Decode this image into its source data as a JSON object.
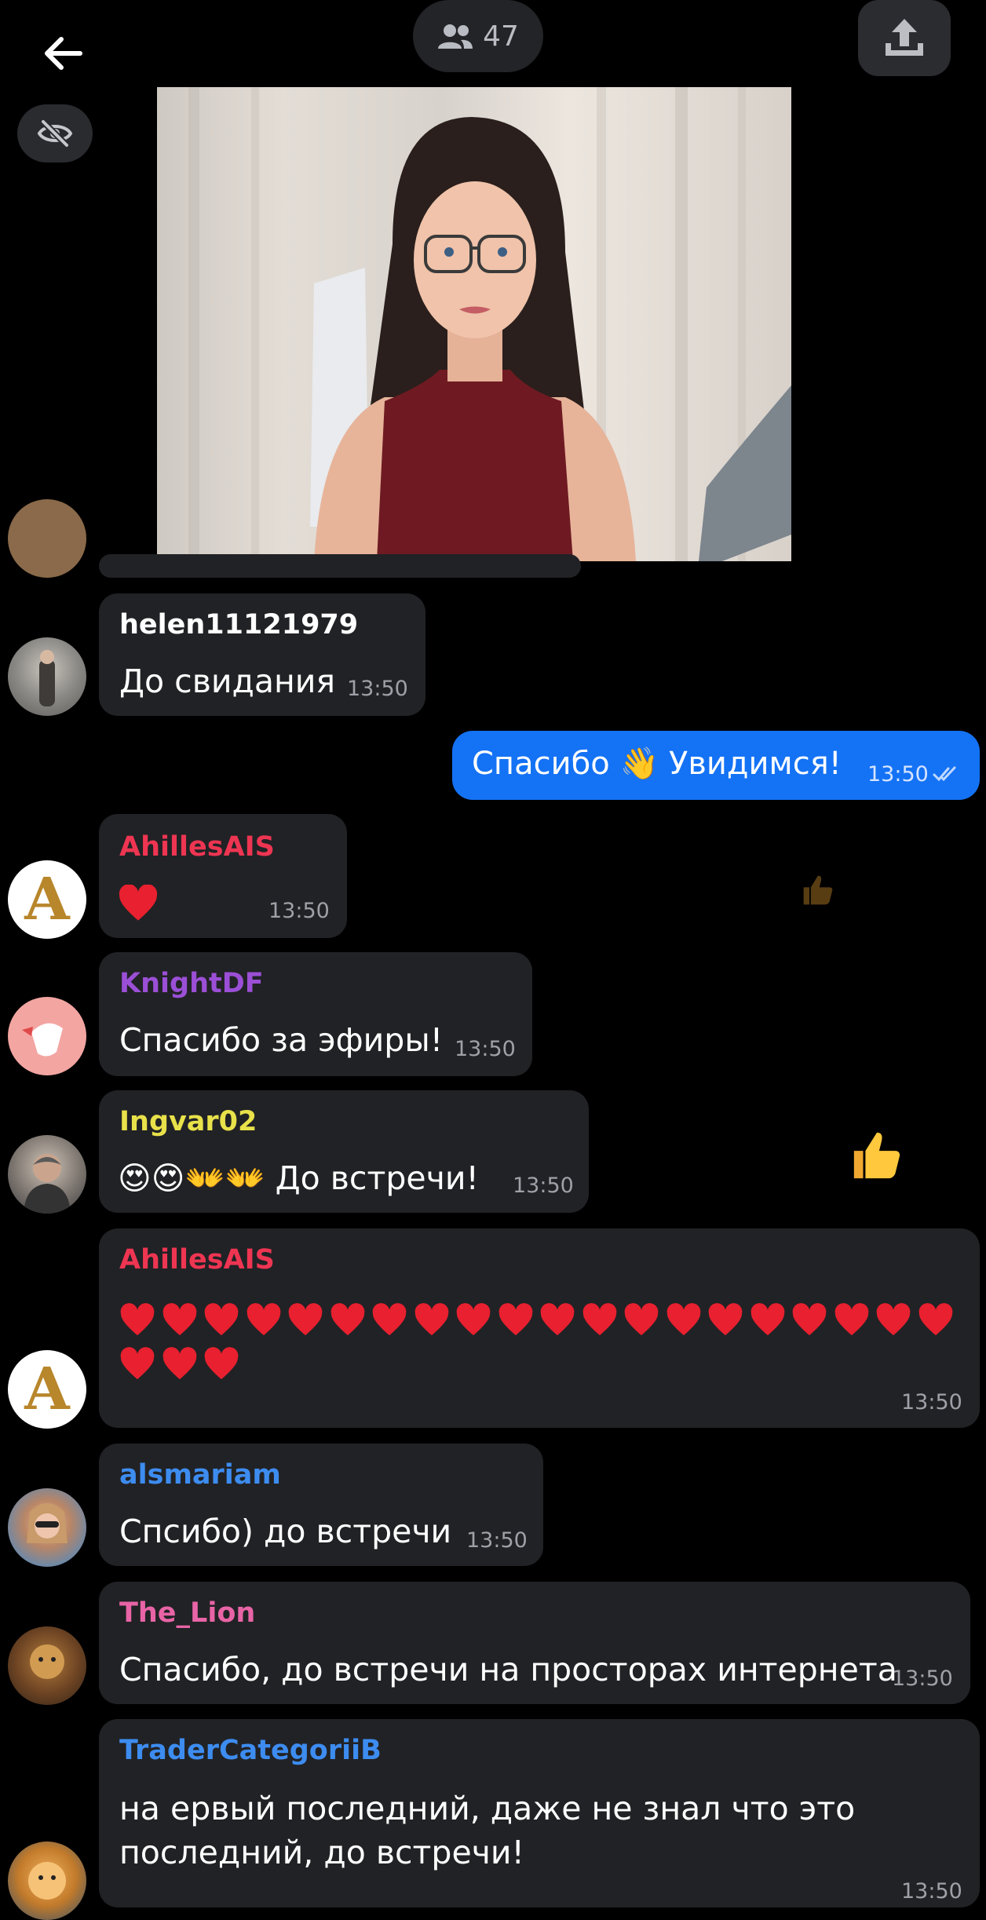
{
  "header": {
    "viewers_count": "47"
  },
  "outgoing": {
    "text": "Спасибо 👋 Увидимся!",
    "time": "13:50"
  },
  "messages": [
    {
      "user": "helen11121979",
      "text": "До свидания",
      "time": "13:50",
      "color": "#ffffff"
    },
    {
      "user": "AhillesAIS",
      "text": "❤️",
      "time": "13:50",
      "color": "#ee3552"
    },
    {
      "user": "KnightDF",
      "text": "Спасибо за эфиры!",
      "time": "13:50",
      "color": "#9b4fd6"
    },
    {
      "user": "Ingvar02",
      "text": "😍😍👐👐 До встречи!",
      "time": "13:50",
      "color": "#e8e14a"
    },
    {
      "user": "AhillesAIS",
      "hearts": 23,
      "time": "13:50",
      "color": "#ee3552"
    },
    {
      "user": "alsmariam",
      "text": "Спсибо) до встречи",
      "time": "13:50",
      "color": "#3d8cf0"
    },
    {
      "user": "The_Lion",
      "text": "Спасибо, до встречи на просторах интернета",
      "time": "13:50",
      "color": "#e864a6"
    },
    {
      "user": "TraderCategoriiB",
      "text_line1": "на ервый  последний, даже не знал что это",
      "text_line2": "последний, до встречи!",
      "time": "13:50",
      "color": "#3d8cf0"
    }
  ],
  "reactions": [
    "👍",
    "👍"
  ],
  "colors": {
    "background": "#000000",
    "bubble": "#212225",
    "outgoing_bubble": "#1472f5"
  }
}
